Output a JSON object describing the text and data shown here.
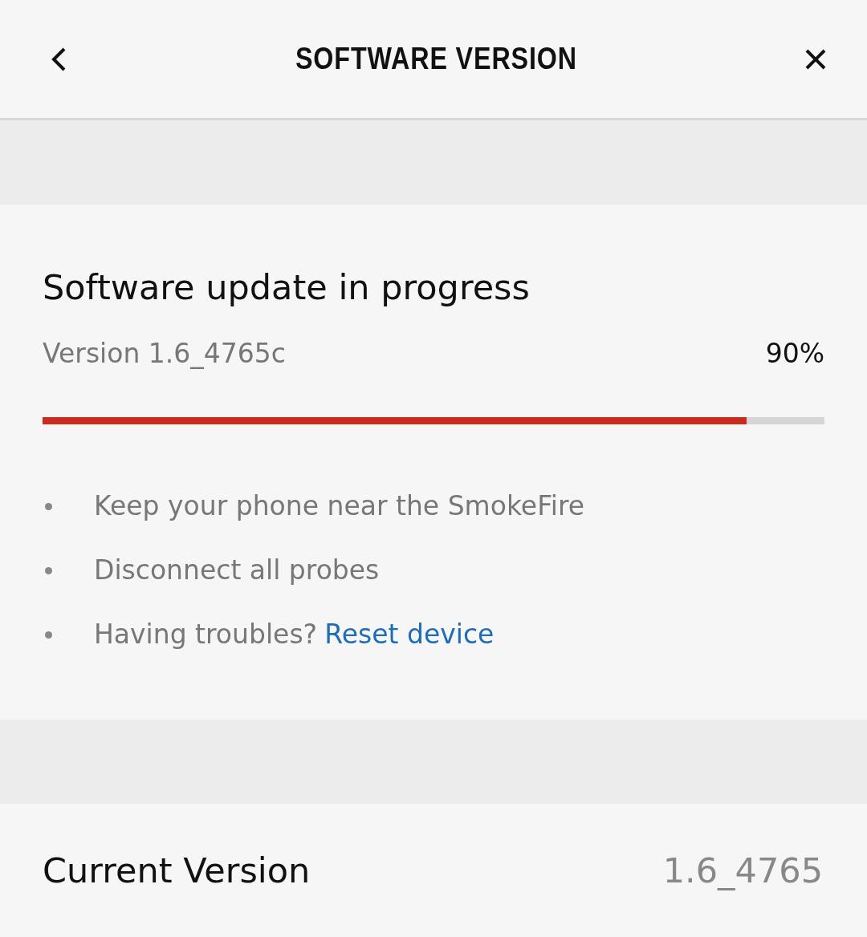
{
  "header": {
    "title": "SOFTWARE VERSION"
  },
  "update": {
    "title": "Software update in progress",
    "version": "Version 1.6_4765c",
    "percent": "90%",
    "level": 0.9
  },
  "tips": [
    {
      "text": "Keep your phone near the SmokeFire"
    },
    {
      "text": "Disconnect all probes"
    },
    {
      "text": "Having troubles?",
      "link": "Reset device"
    }
  ],
  "current": {
    "label": "Current Version",
    "value": "1.6_4765"
  }
}
